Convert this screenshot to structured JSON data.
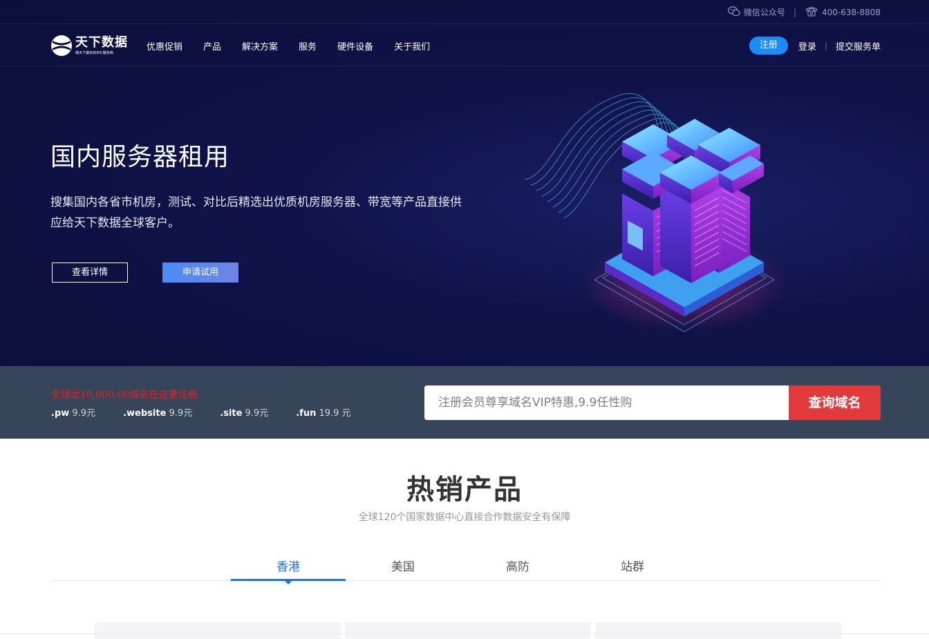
{
  "topbar": {
    "wechat_label": "微信公众号",
    "phone": "400-638-8808",
    "separator": "|",
    "icons": [
      "wechat-icon",
      "phone-icon"
    ]
  },
  "brand": {
    "name": "天下数据",
    "slogan": "做天下最好的IDC服务商"
  },
  "nav": {
    "items": [
      {
        "label": "优惠促销"
      },
      {
        "label": "产品"
      },
      {
        "label": "解决方案"
      },
      {
        "label": "服务"
      },
      {
        "label": "硬件设备"
      },
      {
        "label": "关于我们"
      }
    ],
    "register": "注册",
    "login": "登录",
    "separator": "|",
    "ticket": "提交服务单"
  },
  "hero": {
    "title": "国内服务器租用",
    "description": "搜集国内各省市机房，测试、对比后精选出优质机房服务器、带宽等产品直接供应给天下数据全球客户。",
    "detail_button": "查看详情",
    "trial_button": "申请试用"
  },
  "domain": {
    "promo": "全球近10,000,00域名在这里注册",
    "tlds": [
      {
        "ext": ".pw",
        "price": "9.9元"
      },
      {
        "ext": ".website",
        "price": "9.9元"
      },
      {
        "ext": ".site",
        "price": "9.9元"
      },
      {
        "ext": ".fun",
        "price": "19.9 元"
      }
    ],
    "search_placeholder": "注册会员尊享域名VIP特惠,9.9任性购",
    "search_button": "查询域名"
  },
  "products": {
    "title": "热销产品",
    "subtitle": "全球120个国家数据中心直接合作数据安全有保障",
    "tabs": [
      {
        "label": "香港",
        "active": true
      },
      {
        "label": "美国",
        "active": false
      },
      {
        "label": "高防",
        "active": false
      },
      {
        "label": "站群",
        "active": false
      }
    ]
  },
  "colors": {
    "hero_bg": "#0c0e3a",
    "accent_blue": "#1a8cff",
    "tab_active": "#1a73e8",
    "search_red": "#e23a3a",
    "domain_bar": "#37455b",
    "promo_red": "#e8201c"
  }
}
